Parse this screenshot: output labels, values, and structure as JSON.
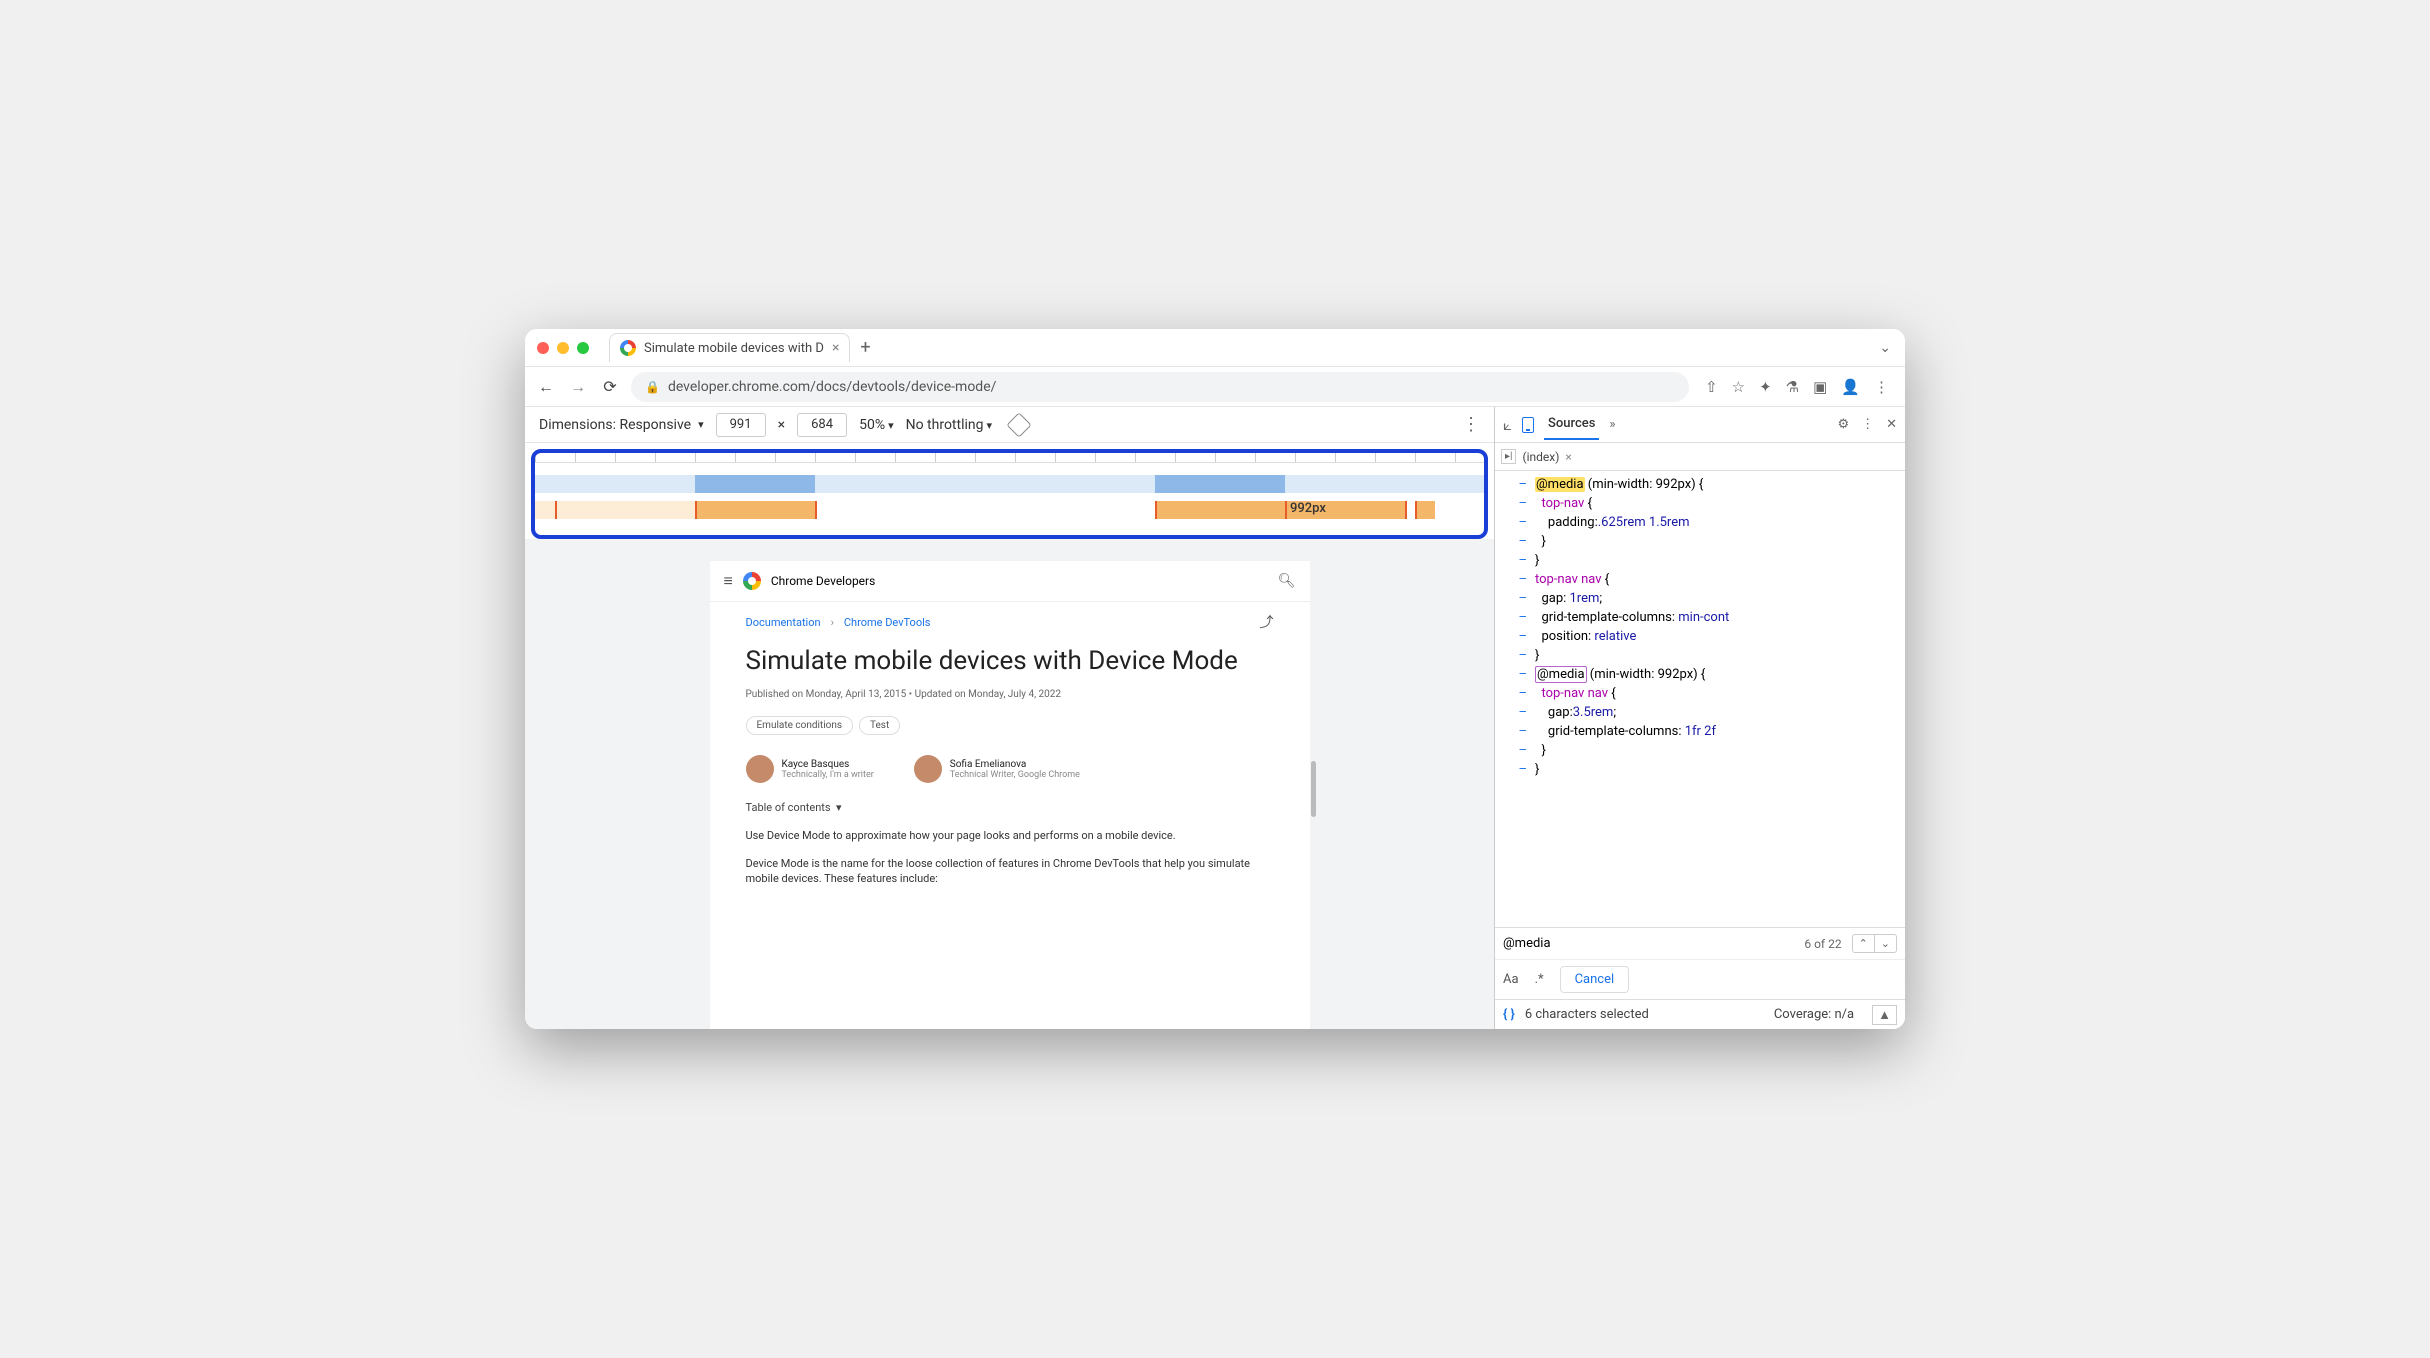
{
  "browser": {
    "tab_title": "Simulate mobile devices with D",
    "url": "developer.chrome.com/docs/devtools/device-mode/"
  },
  "device_toolbar": {
    "dimensions_label": "Dimensions: Responsive",
    "width": "991",
    "height": "684",
    "zoom": "50%",
    "throttling": "No throttling",
    "media_label": "992px"
  },
  "page": {
    "site_name": "Chrome Developers",
    "crumb1": "Documentation",
    "crumb2": "Chrome DevTools",
    "title": "Simulate mobile devices with Device Mode",
    "meta": "Published on Monday, April 13, 2015 • Updated on Monday, July 4, 2022",
    "tag1": "Emulate conditions",
    "tag2": "Test",
    "author1_name": "Kayce Basques",
    "author1_role": "Technically, I'm a writer",
    "author2_name": "Sofia Emelianova",
    "author2_role": "Technical Writer, Google Chrome",
    "toc": "Table of contents",
    "para1": "Use Device Mode to approximate how your page looks and performs on a mobile device.",
    "para2": "Device Mode is the name for the loose collection of features in Chrome DevTools that help you simulate mobile devices. These features include:"
  },
  "devtools": {
    "panel": "Sources",
    "open_tab": "(index)",
    "code": [
      {
        "g": "–",
        "pre": "",
        "hl": "@media",
        "post": " (min-width: 992px) {",
        "cls": "hl"
      },
      {
        "g": "–",
        "pre": "  ",
        "sel": "top-nav",
        "post": " {"
      },
      {
        "g": "–",
        "pre": "    ",
        "prop": "padding:",
        ".v": ".625rem 1.5rem"
      },
      {
        "g": "–",
        "pre": "  }"
      },
      {
        "g": "–",
        "pre": "}"
      },
      {
        "g": "",
        "pre": ""
      },
      {
        "g": "–",
        "pre": "",
        "sel": "top-nav nav",
        "post": " {"
      },
      {
        "g": "–",
        "pre": "  ",
        "prop": "gap: ",
        ".v": "1rem",
        ";": ";"
      },
      {
        "g": "–",
        "pre": "  ",
        "prop": "grid-template-columns: ",
        ".v": "min-cont"
      },
      {
        "g": "–",
        "pre": "  ",
        "prop": "position: ",
        ".v": "relative"
      },
      {
        "g": "–",
        "pre": "}"
      },
      {
        "g": "",
        "pre": ""
      },
      {
        "g": "–",
        "pre": "",
        "hl": "@media",
        "post": " (min-width: 992px) {",
        "cls": "box"
      },
      {
        "g": "–",
        "pre": "  ",
        "sel": "top-nav nav",
        "post": " {"
      },
      {
        "g": "–",
        "pre": "    ",
        "prop": "gap:",
        ".v": "3.5rem",
        ";": ";"
      },
      {
        "g": "–",
        "pre": "    ",
        "prop": "grid-template-columns: ",
        ".v": "1fr 2f"
      },
      {
        "g": "–",
        "pre": "  }"
      },
      {
        "g": "–",
        "pre": "}"
      }
    ],
    "search_value": "@media",
    "search_count": "6 of 22",
    "cancel": "Cancel",
    "case": "Aa",
    "regex": ".*",
    "status_sel": "6 characters selected",
    "status_cov": "Coverage: n/a",
    "braces": "{ }"
  }
}
